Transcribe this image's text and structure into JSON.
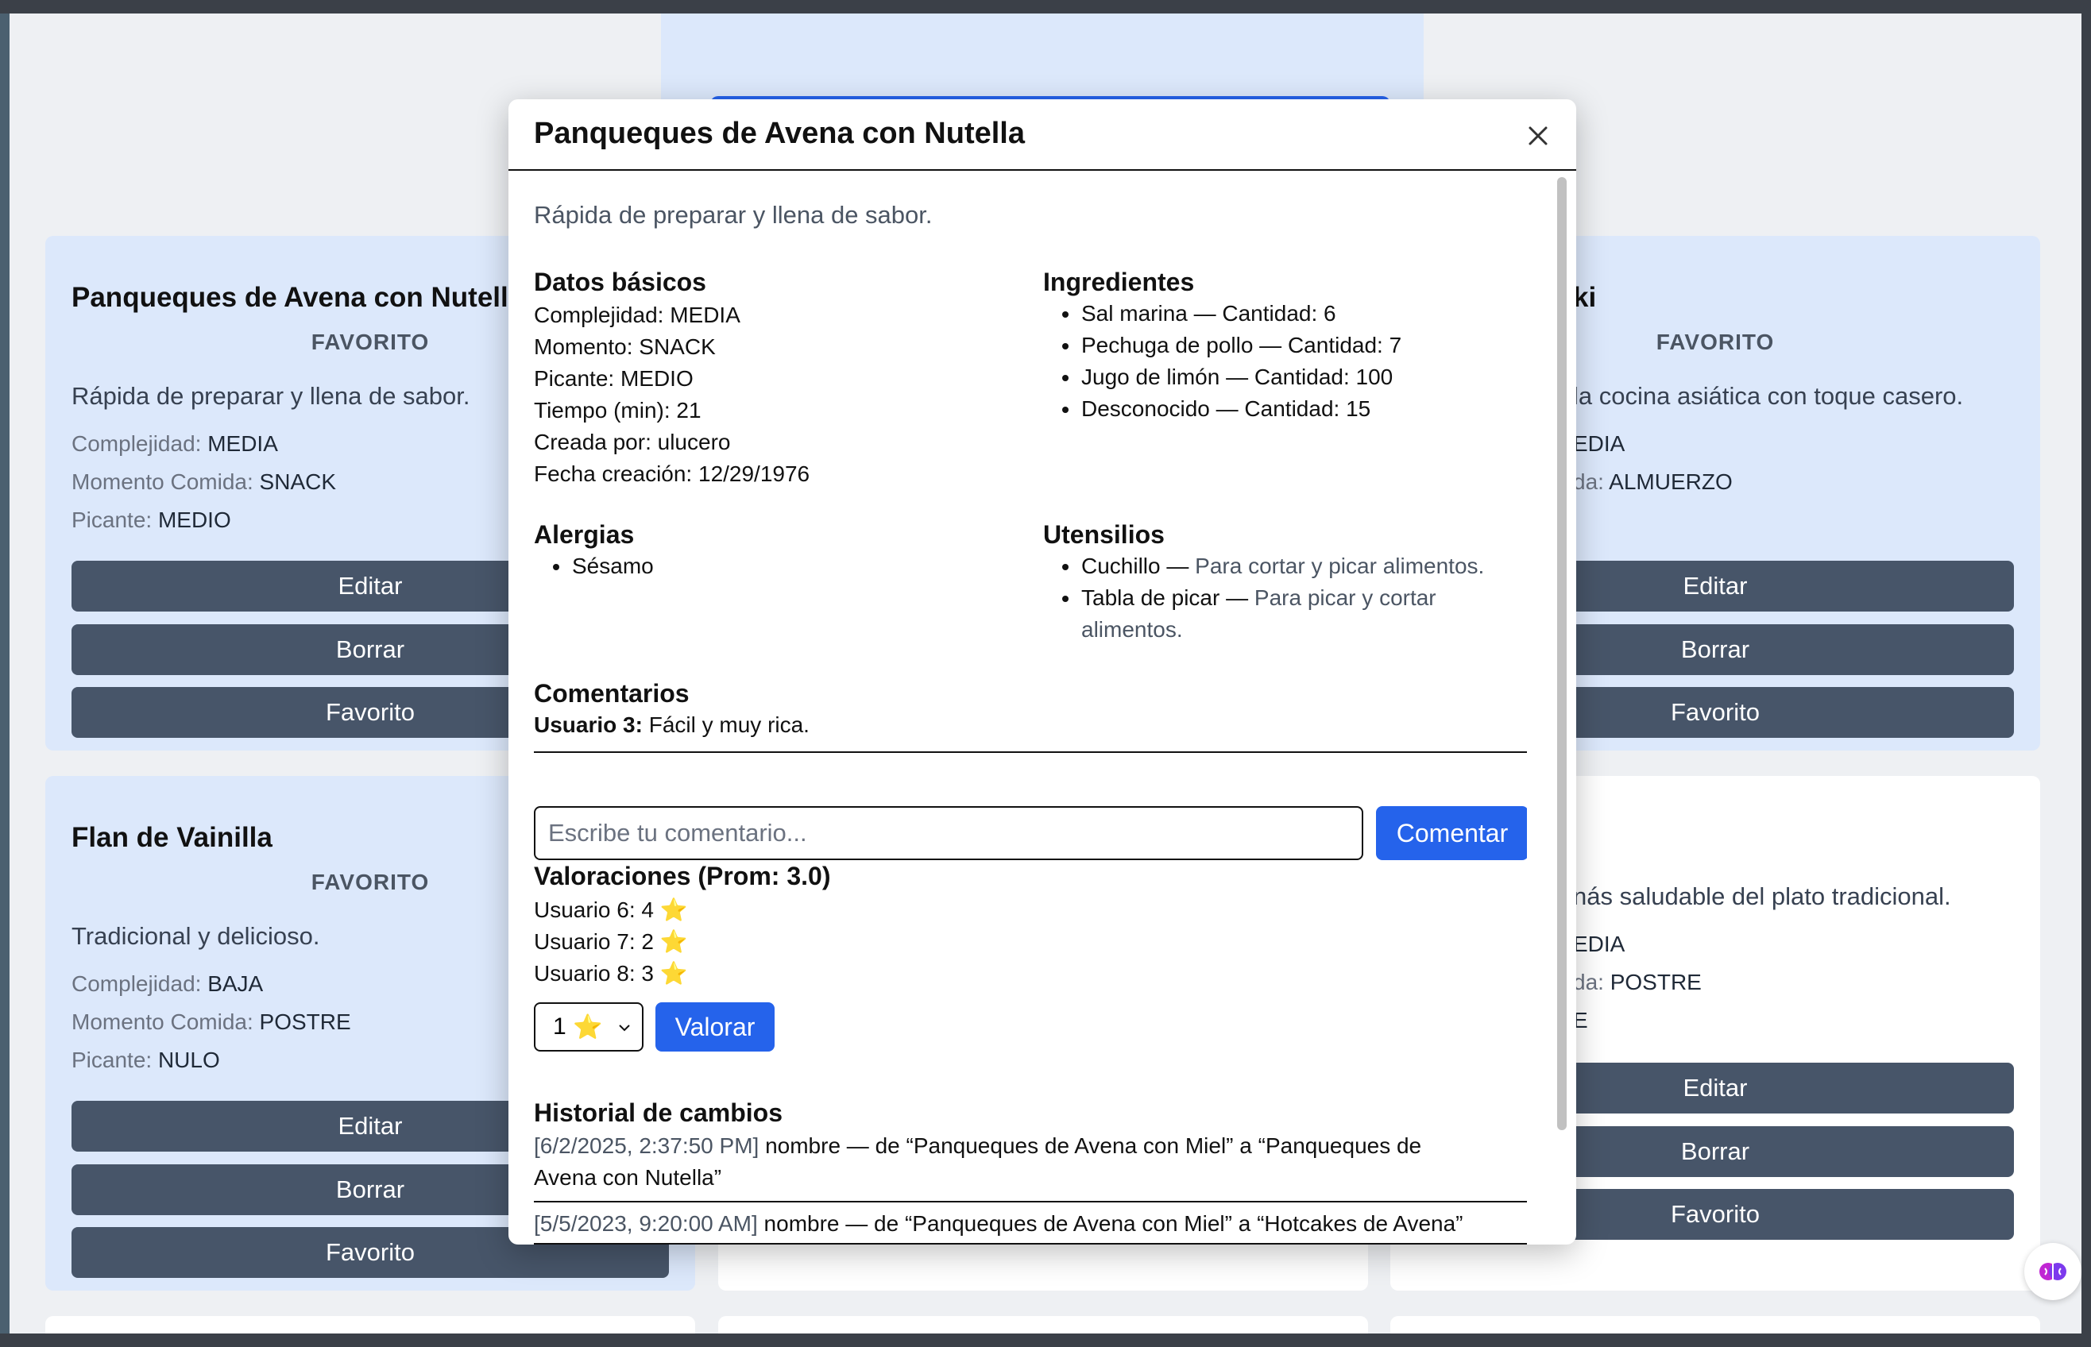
{
  "cards": [
    {
      "title": "Panqueques de Avena con Nutella",
      "fav": "FAVORITO",
      "desc": "Rápida de preparar y llena de sabor.",
      "meta": [
        {
          "k": "Complejidad: ",
          "v": "MEDIA"
        },
        {
          "k": "Momento Comida: ",
          "v": "SNACK"
        },
        {
          "k": "Picante: ",
          "v": "MEDIO"
        }
      ]
    },
    {
      "title": "ki",
      "fav": "FAVORITO",
      "desc": "la cocina asiática con toque casero.",
      "meta": [
        {
          "k": "",
          "v": "EDIA"
        },
        {
          "k": "da: ",
          "v": "ALMUERZO"
        }
      ]
    },
    {
      "title": "Flan de Vainilla",
      "fav": "FAVORITO",
      "desc": "Tradicional y delicioso.",
      "meta": [
        {
          "k": "Complejidad: ",
          "v": "BAJA"
        },
        {
          "k": "Momento Comida: ",
          "v": "POSTRE"
        },
        {
          "k": "Picante: ",
          "v": "NULO"
        }
      ]
    },
    {
      "title": "",
      "fav": "",
      "desc": "nás saludable del plato tradicional.",
      "meta": [
        {
          "k": "",
          "v": "EDIA"
        },
        {
          "k": "da: ",
          "v": "POSTRE"
        },
        {
          "k": "",
          "v": "E"
        }
      ]
    }
  ],
  "card_buttons": {
    "edit": "Editar",
    "delete": "Borrar",
    "favorite": "Favorito"
  },
  "modal": {
    "title": "Panqueques de Avena con Nutella",
    "description": "Rápida de preparar y llena de sabor.",
    "basic": {
      "heading": "Datos básicos",
      "lines": [
        "Complejidad: MEDIA",
        "Momento: SNACK",
        "Picante: MEDIO",
        "Tiempo (min): 21",
        "Creada por: ulucero",
        "Fecha creación: 12/29/1976"
      ]
    },
    "ingredients": {
      "heading": "Ingredientes",
      "items": [
        "Sal marina — Cantidad: 6",
        "Pechuga de pollo — Cantidad: 7",
        "Jugo de limón — Cantidad: 100",
        "Desconocido — Cantidad: 15"
      ]
    },
    "allergies": {
      "heading": "Alergias",
      "items": [
        "Sésamo"
      ]
    },
    "utensils": {
      "heading": "Utensilios",
      "items": [
        {
          "name": "Cuchillo — ",
          "desc": "Para cortar y picar alimentos."
        },
        {
          "name": "Tabla de picar — ",
          "desc": "Para picar y cortar",
          "desc2": "alimentos."
        }
      ]
    },
    "comments": {
      "heading": "Comentarios",
      "list": [
        {
          "user": "Usuario 3:",
          "text": " Fácil y muy rica."
        }
      ],
      "placeholder": "Escribe tu comentario...",
      "submit": "Comentar"
    },
    "ratings": {
      "heading": "Valoraciones (Prom: 3.0)",
      "list": [
        "Usuario 6: 4",
        "Usuario 7: 2",
        "Usuario 8: 3"
      ],
      "star": "⭐",
      "selected": "1",
      "submit": "Valorar"
    },
    "history": {
      "heading": "Historial de cambios",
      "entries": [
        {
          "ts": "[6/2/2025, 2:37:50 PM]",
          "text": " nombre — de “Panqueques de Avena con Miel” a “Panqueques de",
          "text2": "Avena con Nutella”"
        },
        {
          "ts": "[5/5/2023, 9:20:00 AM]",
          "text": " nombre — de “Panqueques de Avena con Miel” a “Hotcakes de Avena”"
        }
      ]
    }
  }
}
